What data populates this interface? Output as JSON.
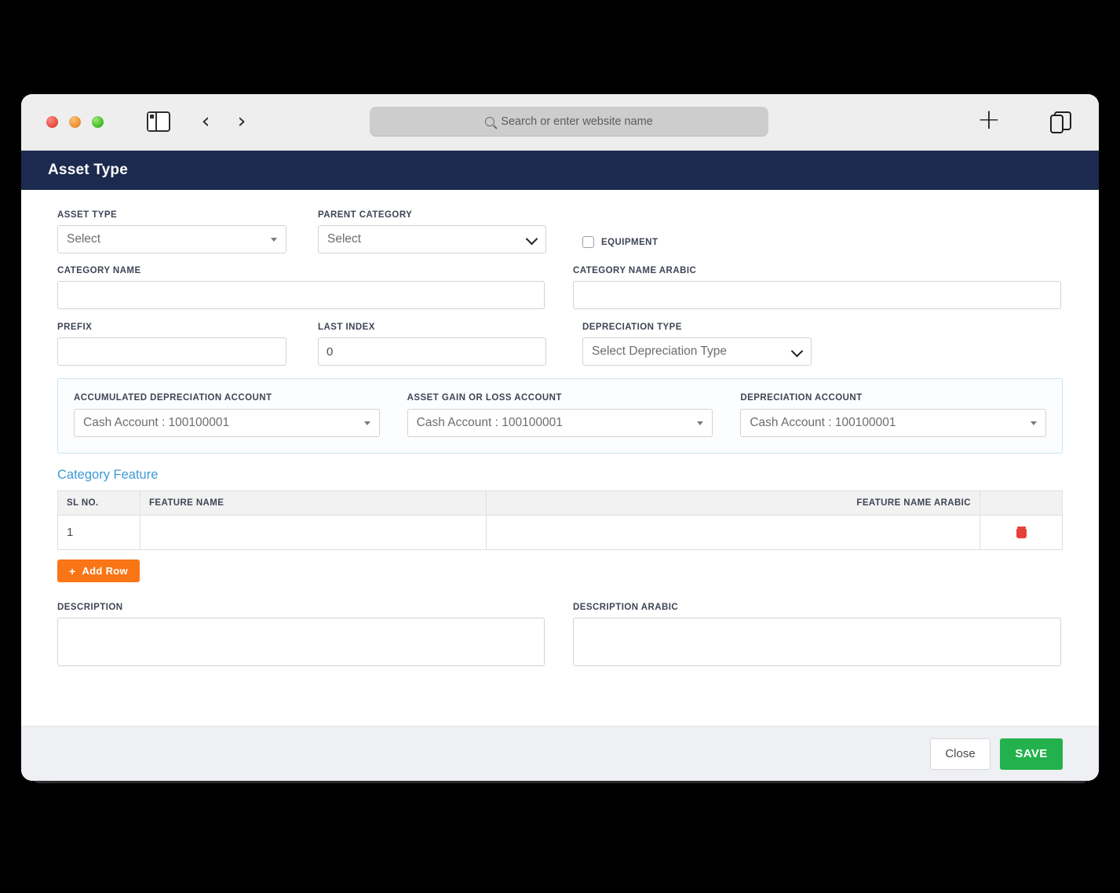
{
  "browser": {
    "search_placeholder": "Search or enter website name",
    "icons": {
      "sidebar": "sidebar-toggle-icon",
      "back": "‹",
      "forward": "›",
      "new_tab": "+",
      "tab_overview": "tabs-icon",
      "search": "search-icon"
    }
  },
  "header": {
    "title": "Asset Type",
    "background": "#1b2a4e"
  },
  "form": {
    "asset_type": {
      "label": "ASSET TYPE",
      "value": "Select"
    },
    "parent_category": {
      "label": "PARENT CATEGORY",
      "value": "Select"
    },
    "equipment": {
      "label": "EQUIPMENT",
      "checked": false
    },
    "category_name": {
      "label": "CATEGORY NAME",
      "value": ""
    },
    "category_name_arabic": {
      "label": "CATEGORY NAME ARABIC",
      "value": ""
    },
    "prefix": {
      "label": "PREFIX",
      "value": ""
    },
    "last_index": {
      "label": "LAST INDEX",
      "value": "0"
    },
    "depreciation_type": {
      "label": "DEPRECIATION TYPE",
      "value": "Select Depreciation Type"
    },
    "description": {
      "label": "DESCRIPTION",
      "value": ""
    },
    "description_arabic": {
      "label": "DESCRIPTION ARABIC",
      "value": ""
    }
  },
  "accounts": {
    "accumulated_depreciation": {
      "label": "ACCUMULATED DEPRECIATION ACCOUNT",
      "value": "Cash Account : 100100001"
    },
    "asset_gain_or_loss": {
      "label": "ASSET GAIN OR LOSS ACCOUNT",
      "value": "Cash Account : 100100001"
    },
    "depreciation": {
      "label": "DEPRECIATION ACCOUNT",
      "value": "Cash Account : 100100001"
    }
  },
  "category_feature": {
    "title": "Category Feature",
    "title_color": "#3d9ad6",
    "columns": [
      "SL NO.",
      "FEATURE NAME",
      "FEATURE NAME ARABIC",
      ""
    ],
    "rows": [
      {
        "sl_no": "1",
        "feature_name": "",
        "feature_name_arabic": "",
        "delete_icon": "trash-icon"
      }
    ],
    "add_row_label": "Add Row",
    "add_row_plus": "+",
    "add_row_color": "#f97515"
  },
  "footer": {
    "close_label": "Close",
    "save_label": "SAVE",
    "save_color": "#22b14c"
  }
}
